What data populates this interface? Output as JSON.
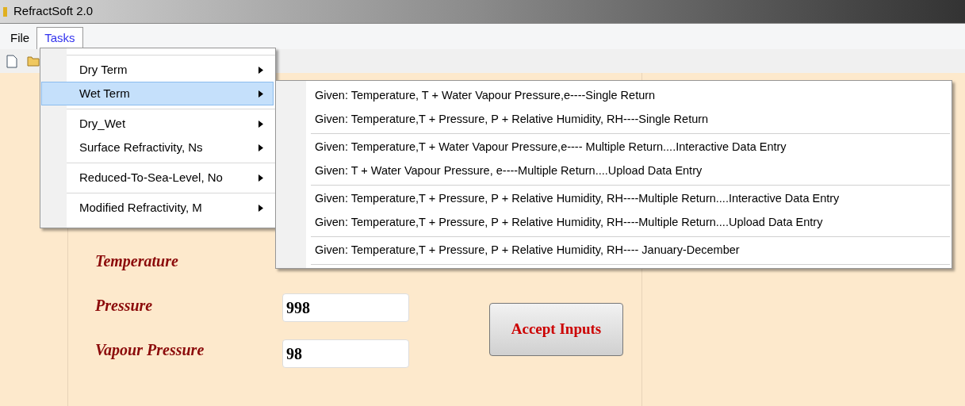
{
  "window": {
    "title": "RefractSoft 2.0"
  },
  "menu_bar": [
    {
      "label": "File",
      "selected": false
    },
    {
      "label": "Tasks",
      "selected": true
    }
  ],
  "tasks_menu": {
    "groups": [
      [
        {
          "label": "Dry Term",
          "selected": false
        },
        {
          "label": "Wet Term",
          "selected": true
        }
      ],
      [
        {
          "label": "Dry_Wet",
          "selected": false
        },
        {
          "label": "Surface Refractivity, Ns",
          "selected": false
        }
      ],
      [
        {
          "label": "Reduced-To-Sea-Level, No",
          "selected": false
        }
      ],
      [
        {
          "label": "Modified Refractivity, M",
          "selected": false
        }
      ]
    ]
  },
  "wet_term_menu": {
    "groups": [
      [
        "Given: Temperature, T + Water Vapour Pressure,e----Single Return",
        "Given: Temperature,T + Pressure, P +  Relative Humidity, RH----Single Return"
      ],
      [
        "Given: Temperature,T + Water Vapour Pressure,e---- Multiple Return....Interactive Data Entry",
        "Given: T +  Water Vapour Pressure, e----Multiple Return....Upload Data Entry"
      ],
      [
        "Given: Temperature,T + Pressure, P +  Relative Humidity, RH----Multiple Return....Interactive Data Entry",
        "Given: Temperature,T + Pressure, P +  Relative Humidity, RH----Multiple Return....Upload Data Entry"
      ],
      [
        "Given: Temperature,T + Pressure, P +  Relative Humidity, RH---- January-December"
      ]
    ]
  },
  "form": {
    "fields": [
      {
        "label": "Temperature"
      },
      {
        "label": "Pressure",
        "value": "998"
      },
      {
        "label": "Vapour Pressure",
        "value": "98"
      }
    ],
    "accept_button": "Accept Inputs"
  }
}
